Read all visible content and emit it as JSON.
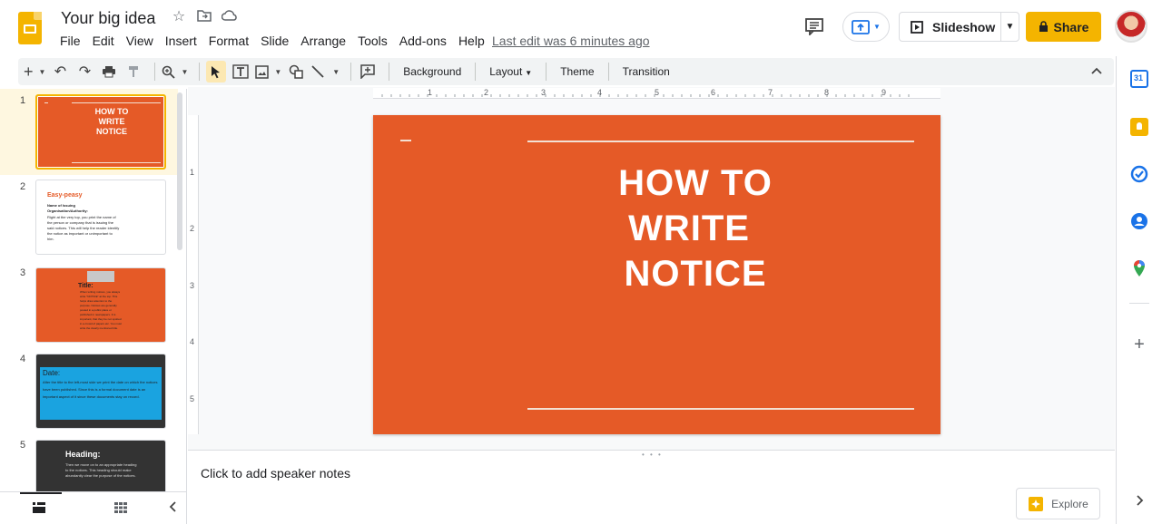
{
  "app": {
    "doc_title": "Your big idea",
    "last_edit": "Last edit was 6 minutes ago"
  },
  "menu": [
    "File",
    "Edit",
    "View",
    "Insert",
    "Format",
    "Slide",
    "Arrange",
    "Tools",
    "Add-ons",
    "Help"
  ],
  "header": {
    "slideshow_label": "Slideshow",
    "share_label": "Share"
  },
  "toolbar": {
    "background_label": "Background",
    "layout_label": "Layout",
    "theme_label": "Theme",
    "transition_label": "Transition"
  },
  "ruler": {
    "horizontal": [
      "1",
      "2",
      "3",
      "4",
      "5",
      "6",
      "7",
      "8",
      "9"
    ],
    "vertical": [
      "1",
      "2",
      "3",
      "4",
      "5"
    ]
  },
  "slides": [
    {
      "number": "1",
      "title": "HOW TO\nWRITE\nNOTICE"
    },
    {
      "number": "2",
      "heading": "Easy-peasy",
      "subheading": "Name of Issuing Organisation/Authority:",
      "body": "Right at the very top, you print the name of the person or company that is issuing the said notices. This will help the reader identify the notice as important or unimportant to him."
    },
    {
      "number": "3",
      "heading": "Title:",
      "body": "When writing notices, you always write \"NOTICE\" at the top. This helps draw attention to the purpose. Notices are generally posted in a public place or published in newspapers. It is important, that they be not spotted in a crowd of papers etc. You must write the clearly mentioned title."
    },
    {
      "number": "4",
      "heading": "Date:",
      "body": "After the title to the left-most side we print the date on which the notices have been published. Since this is a formal document date is an important aspect of it since these documents stay on record."
    },
    {
      "number": "5",
      "heading": "Heading:",
      "body": "Then we move on to an appropriate heading to the notices. This heading should make abundantly clear the purpose of the notices."
    }
  ],
  "main_slide": {
    "title_line1": "HOW TO",
    "title_line2": "WRITE",
    "title_line3": "NOTICE",
    "background_color": "#e55a27"
  },
  "notes": {
    "placeholder": "Click to add speaker notes"
  },
  "explore": {
    "label": "Explore"
  },
  "side_panel": {
    "calendar_date": "31"
  }
}
